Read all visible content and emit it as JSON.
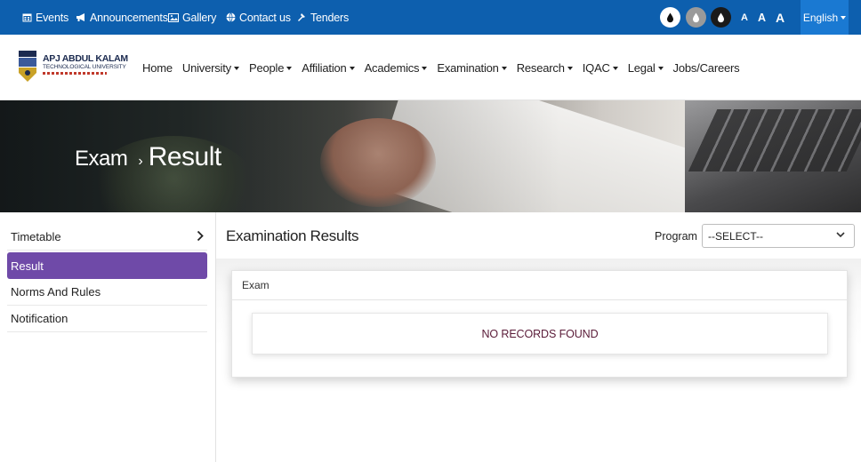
{
  "topbar": {
    "links": [
      {
        "label": "Events",
        "icon": "calendar-icon"
      },
      {
        "label": "Announcements",
        "icon": "megaphone-icon"
      },
      {
        "label": "Gallery",
        "icon": "image-icon"
      },
      {
        "label": "Contact us",
        "icon": "globe-icon"
      },
      {
        "label": "Tenders",
        "icon": "hammer-icon"
      }
    ],
    "contrast_icons": [
      "contrast-dark-drop-icon",
      "contrast-light-drop-icon",
      "contrast-black-drop-icon"
    ],
    "font_sizes": [
      "A",
      "A",
      "A"
    ],
    "language": "English",
    "bg_color": "#0d5fae"
  },
  "logo": {
    "line1": "APJ ABDUL KALAM",
    "line2": "TECHNOLOGICAL UNIVERSITY"
  },
  "nav": {
    "items": [
      {
        "label": "Home",
        "dropdown": false
      },
      {
        "label": "University",
        "dropdown": true
      },
      {
        "label": "People",
        "dropdown": true
      },
      {
        "label": "Affiliation",
        "dropdown": true
      },
      {
        "label": "Academics",
        "dropdown": true
      },
      {
        "label": "Examination",
        "dropdown": true
      },
      {
        "label": "Research",
        "dropdown": true
      },
      {
        "label": "IQAC",
        "dropdown": true
      },
      {
        "label": "Legal",
        "dropdown": true
      },
      {
        "label": "Jobs/Careers",
        "dropdown": false
      }
    ]
  },
  "banner": {
    "crumb": "Exam",
    "separator": "›",
    "current": "Result"
  },
  "sidebar": {
    "items": [
      {
        "label": "Timetable",
        "active": false,
        "has_chevron": true
      },
      {
        "label": "Result",
        "active": true,
        "has_chevron": false
      },
      {
        "label": "Norms And Rules",
        "active": false,
        "has_chevron": false
      },
      {
        "label": "Notification",
        "active": false,
        "has_chevron": false
      }
    ],
    "active_color": "#6f4aa8"
  },
  "main": {
    "title": "Examination Results",
    "program_label": "Program",
    "program_select": "--SELECT--",
    "card_header": "Exam",
    "empty_message": "NO RECORDS FOUND"
  }
}
